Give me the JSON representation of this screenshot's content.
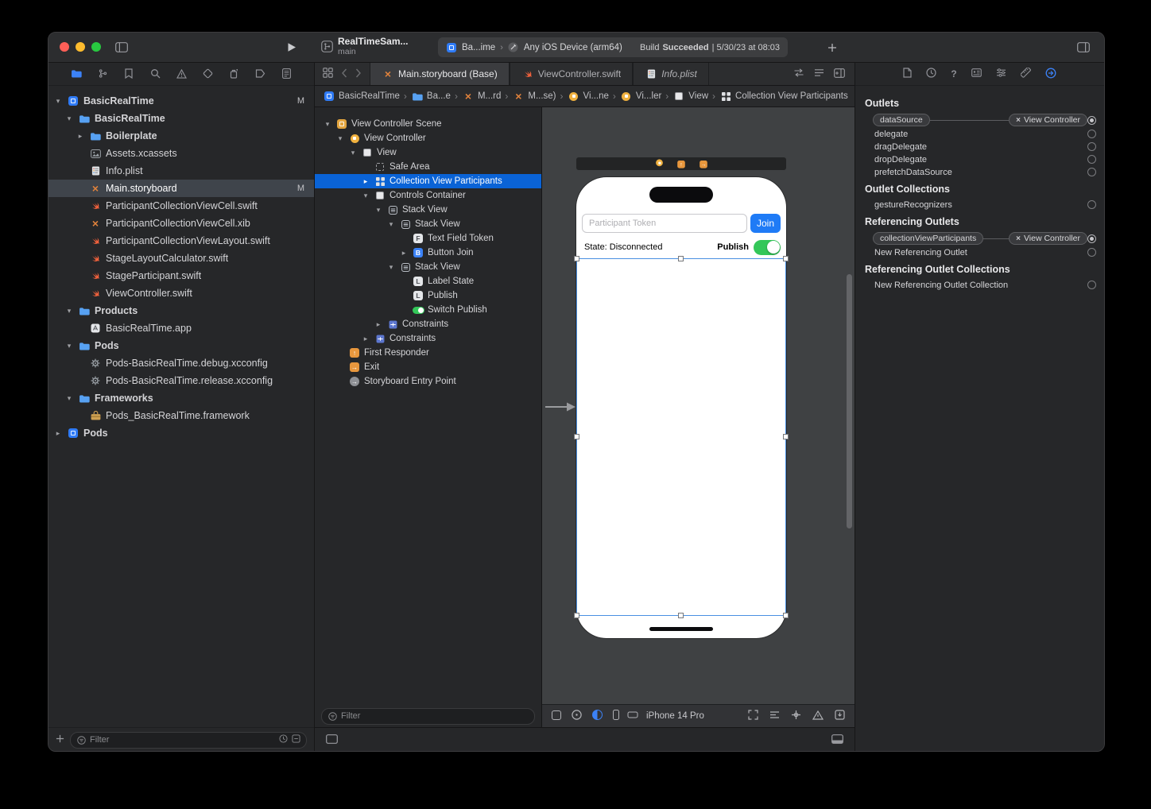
{
  "colors": {
    "accent_blue": "#0a63d6",
    "join_button_blue": "#1f7bf6",
    "switch_green": "#34c759",
    "selection_blue": "#4a90e2",
    "storyboard_orange": "#e0823c",
    "traffic_red": "#ff5f57",
    "traffic_yellow": "#febc2e",
    "traffic_green": "#28c840"
  },
  "toolbar": {
    "project_title": "RealTimeSam...",
    "branch": "main",
    "scheme": "Ba...ime",
    "scheme_chevron": "›",
    "destination": "Any iOS Device (arm64)",
    "build_prefix": "Build",
    "build_status": "Succeeded",
    "build_suffix": "| 5/30/23 at 08:03"
  },
  "navigator": {
    "filter_placeholder": "Filter",
    "items": [
      {
        "icon": "project",
        "label": "BasicRealTime",
        "level": 0,
        "disclosure": "open",
        "badge": "M",
        "bold": true
      },
      {
        "icon": "folder",
        "label": "BasicRealTime",
        "level": 1,
        "disclosure": "open",
        "bold": true
      },
      {
        "icon": "folder",
        "label": "Boilerplate",
        "level": 2,
        "disclosure": "closed",
        "bold": true
      },
      {
        "icon": "assets",
        "label": "Assets.xcassets",
        "level": 2
      },
      {
        "icon": "plist",
        "label": "Info.plist",
        "level": 2
      },
      {
        "icon": "storyboard",
        "label": "Main.storyboard",
        "level": 2,
        "badge": "M",
        "selected": true
      },
      {
        "icon": "swift",
        "label": "ParticipantCollectionViewCell.swift",
        "level": 2
      },
      {
        "icon": "xib",
        "label": "ParticipantCollectionViewCell.xib",
        "level": 2
      },
      {
        "icon": "swift",
        "label": "ParticipantCollectionViewLayout.swift",
        "level": 2
      },
      {
        "icon": "swift",
        "label": "StageLayoutCalculator.swift",
        "level": 2
      },
      {
        "icon": "swift",
        "label": "StageParticipant.swift",
        "level": 2
      },
      {
        "icon": "swift",
        "label": "ViewController.swift",
        "level": 2
      },
      {
        "icon": "folder",
        "label": "Products",
        "level": 1,
        "disclosure": "open",
        "bold": true
      },
      {
        "icon": "appfile",
        "label": "BasicRealTime.app",
        "level": 2
      },
      {
        "icon": "folder",
        "label": "Pods",
        "level": 1,
        "disclosure": "open",
        "bold": true
      },
      {
        "icon": "xcconfig",
        "label": "Pods-BasicRealTime.debug.xcconfig",
        "level": 2
      },
      {
        "icon": "xcconfig",
        "label": "Pods-BasicRealTime.release.xcconfig",
        "level": 2
      },
      {
        "icon": "folder",
        "label": "Frameworks",
        "level": 1,
        "disclosure": "open",
        "bold": true
      },
      {
        "icon": "framework",
        "label": "Pods_BasicRealTime.framework",
        "level": 2
      },
      {
        "icon": "project",
        "label": "Pods",
        "level": 0,
        "disclosure": "closed",
        "bold": true
      }
    ]
  },
  "tabs": [
    {
      "icon": "storyboard",
      "label": "Main.storyboard (Base)",
      "active": true
    },
    {
      "icon": "swift",
      "label": "ViewController.swift",
      "active": false
    },
    {
      "icon": "plist",
      "label": "Info.plist",
      "active": false,
      "italic": true
    }
  ],
  "jumpbar": {
    "items": [
      {
        "icon": "project",
        "label": "BasicRealTime"
      },
      {
        "icon": "folder",
        "label": "Ba...e"
      },
      {
        "icon": "storyboard",
        "label": "M...rd"
      },
      {
        "icon": "storyboard",
        "label": "M...se)"
      },
      {
        "icon": "viewcontroller",
        "label": "Vi...ne"
      },
      {
        "icon": "viewcontroller",
        "label": "Vi...ler"
      },
      {
        "icon": "view",
        "label": "View"
      },
      {
        "icon": "collection",
        "label": "Collection View Participants"
      }
    ]
  },
  "outline": {
    "filter_placeholder": "Filter",
    "items": [
      {
        "icon": "scene",
        "label": "View Controller Scene",
        "level": 0,
        "disclosure": "open",
        "bold": true
      },
      {
        "icon": "viewcontroller",
        "label": "View Controller",
        "level": 1,
        "disclosure": "open"
      },
      {
        "icon": "view",
        "label": "View",
        "level": 2,
        "disclosure": "open"
      },
      {
        "icon": "safearea",
        "label": "Safe Area",
        "level": 3
      },
      {
        "icon": "collection",
        "label": "Collection View Participants",
        "level": 3,
        "disclosure": "closed",
        "selected": true
      },
      {
        "icon": "view",
        "label": "Controls Container",
        "level": 3,
        "disclosure": "open"
      },
      {
        "icon": "stack",
        "label": "Stack View",
        "level": 4,
        "disclosure": "open"
      },
      {
        "icon": "stack",
        "label": "Stack View",
        "level": 5,
        "disclosure": "open"
      },
      {
        "icon": "textfield",
        "label": "Text Field Token",
        "level": 6
      },
      {
        "icon": "button",
        "label": "Button Join",
        "level": 6,
        "disclosure": "closed"
      },
      {
        "icon": "stack",
        "label": "Stack View",
        "level": 5,
        "disclosure": "open"
      },
      {
        "icon": "label",
        "label": "Label State",
        "level": 6
      },
      {
        "icon": "label",
        "label": "Publish",
        "level": 6
      },
      {
        "icon": "switchctl",
        "label": "Switch Publish",
        "level": 6
      },
      {
        "icon": "constraints",
        "label": "Constraints",
        "level": 4,
        "disclosure": "closed"
      },
      {
        "icon": "constraints",
        "label": "Constraints",
        "level": 3,
        "disclosure": "closed"
      },
      {
        "icon": "firstresponder",
        "label": "First Responder",
        "level": 1
      },
      {
        "icon": "exit",
        "label": "Exit",
        "level": 1
      },
      {
        "icon": "entrypoint",
        "label": "Storyboard Entry Point",
        "level": 1
      }
    ]
  },
  "canvas": {
    "device": {
      "token_placeholder": "Participant Token",
      "join_label": "Join",
      "state_label": "State: Disconnected",
      "publish_label": "Publish"
    },
    "device_name": "iPhone 14 Pro"
  },
  "inspector": {
    "sections": [
      {
        "title": "Outlets",
        "rows": [
          {
            "label": "dataSource",
            "connected": true,
            "target": "View Controller"
          },
          {
            "label": "delegate"
          },
          {
            "label": "dragDelegate"
          },
          {
            "label": "dropDelegate"
          },
          {
            "label": "prefetchDataSource"
          }
        ]
      },
      {
        "title": "Outlet Collections",
        "rows": [
          {
            "label": "gestureRecognizers"
          }
        ]
      },
      {
        "title": "Referencing Outlets",
        "rows": [
          {
            "label": "collectionViewParticipants",
            "connected": true,
            "target": "View Controller"
          },
          {
            "label": "New Referencing Outlet"
          }
        ]
      },
      {
        "title": "Referencing Outlet Collections",
        "rows": [
          {
            "label": "New Referencing Outlet Collection"
          }
        ]
      }
    ]
  }
}
